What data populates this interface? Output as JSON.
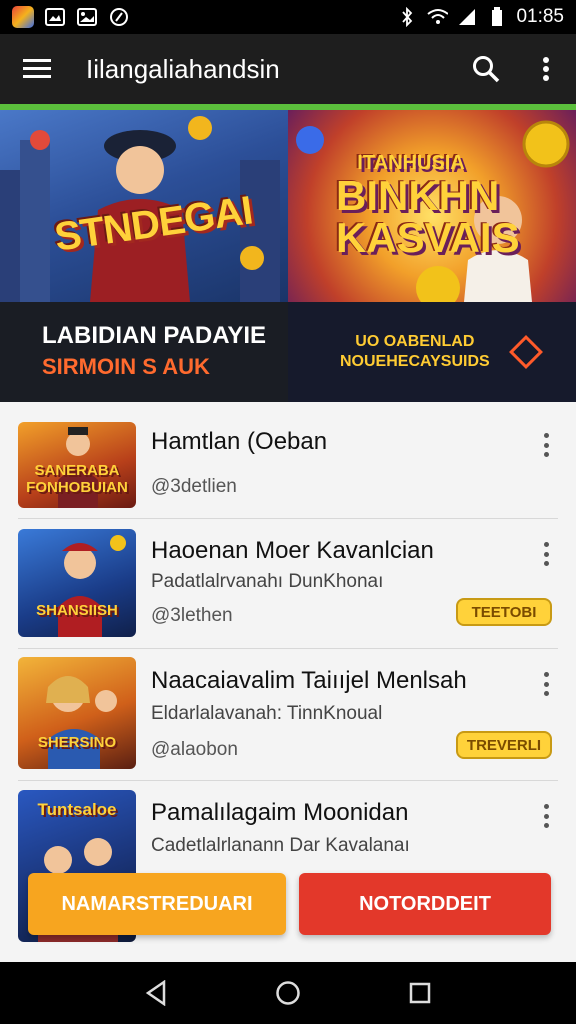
{
  "status_bar": {
    "time": "01:85",
    "icons": [
      "app-thumbnail",
      "gallery-icon",
      "image-icon",
      "media-icon",
      "bluetooth-icon",
      "wifi-icon",
      "signal-icon",
      "battery-icon"
    ]
  },
  "app_bar": {
    "title": "Iilangaliahandsin",
    "icons": [
      "hamburger-menu-icon",
      "search-icon",
      "more-vert-icon"
    ]
  },
  "banner": {
    "art_left_text": "STNDEGAI",
    "art_right_sub": "ITANHUSIA",
    "art_right_main": "BINKHN KASVAIS",
    "headline": "LABIDIAN PADAYIE",
    "subheadline": "SIRMOIN S AUK",
    "cta_line1": "UO OABENLAD",
    "cta_line2": "NOUEHECAYSUIDS",
    "colors": {
      "headline": "#ffffff",
      "sub": "#ff6a2e",
      "cta": "#ffcc33"
    }
  },
  "list": {
    "items": [
      {
        "title": "Hamtlan (Oeban",
        "subtitle": "",
        "meta": "@3detlien",
        "badge": "",
        "thumb_label": "SANERABA FONHOBUIAN"
      },
      {
        "title": "Haoenan Moer Kavanlcian",
        "subtitle": "Padatlalrvanahı DunKhonaı",
        "meta": "@3lethen",
        "badge": "TEETOBI",
        "thumb_label": "SHANSIISH"
      },
      {
        "title": "Naacaiavalim Taiııjel Menlsah",
        "subtitle": "Eldarlalavanah: TinnKnoual",
        "meta": "@alaobon",
        "badge": "TREVERLI",
        "thumb_label": "SHERSINO"
      },
      {
        "title": "Pamalılagaim Moonidan",
        "subtitle": "Cadetlalrlanann Dar Kavalanaı",
        "meta": "",
        "badge": "",
        "thumb_label": "Tuntsaloe"
      }
    ]
  },
  "actions": {
    "primary_label": "NAMARSTREDUARI",
    "secondary_label": "NOTORDDEIT",
    "colors": {
      "primary": "#f7a51f",
      "secondary": "#e3382a"
    }
  },
  "nav": {
    "icons": [
      "back-icon",
      "home-icon",
      "recents-icon"
    ]
  }
}
